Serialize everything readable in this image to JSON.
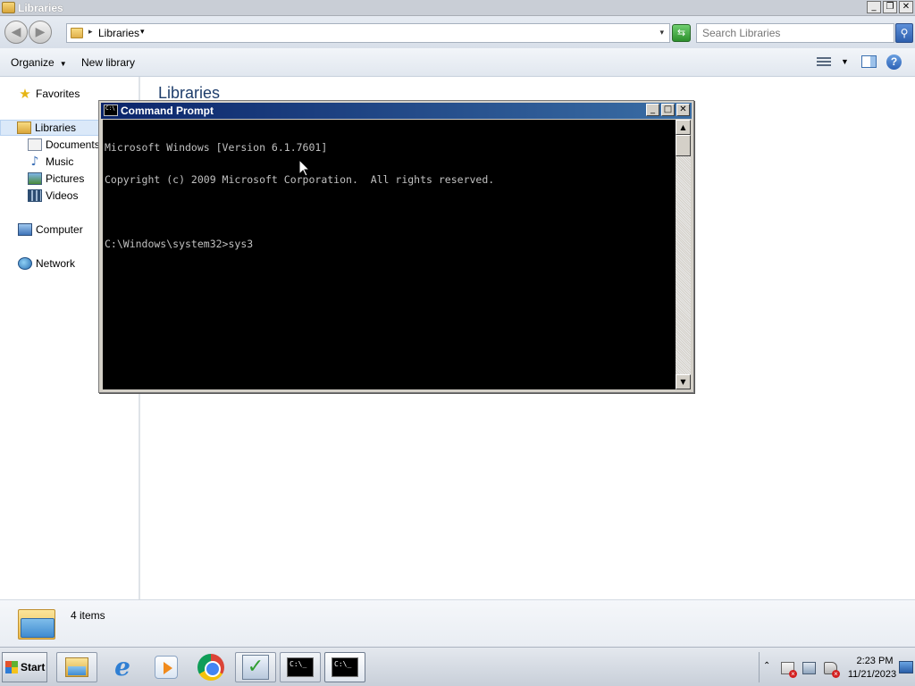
{
  "explorer": {
    "title": "Libraries",
    "window_buttons": [
      "_",
      "❐",
      "✕"
    ],
    "nav": {
      "back": "◀",
      "forward": "▶"
    },
    "address": {
      "path": "Libraries",
      "separator": "▸",
      "arrow": "▾",
      "dropdown": "▾"
    },
    "refresh_glyph": "⇆",
    "search": {
      "placeholder": "Search Libraries",
      "button": "⚲"
    },
    "toolbar": {
      "organize": "Organize",
      "organize_caret": "▼",
      "new_library": "New library",
      "views_caret": "▼",
      "help": "?"
    },
    "sidebar": {
      "favorites": "Favorites",
      "libraries": "Libraries",
      "documents": "Documents",
      "music": "Music",
      "pictures": "Pictures",
      "videos": "Videos",
      "computer": "Computer",
      "network": "Network"
    },
    "content_title": "Libraries",
    "status": {
      "items": "4 items"
    }
  },
  "cmd": {
    "title": "Command Prompt",
    "window_buttons": [
      "_",
      "□",
      "✕"
    ],
    "lines": [
      "Microsoft Windows [Version 6.1.7601]",
      "Copyright (c) 2009 Microsoft Corporation.  All rights reserved.",
      "",
      "C:\\Windows\\system32>sys3"
    ],
    "scroll_up": "▲",
    "scroll_down": "▼"
  },
  "taskbar": {
    "start_label": "Start",
    "cmd_icon_text": "C:\\_",
    "tray_expand": "⌃",
    "time": "2:23 PM",
    "date": "11/21/2023"
  },
  "colors": {
    "console_bg": "#000000",
    "console_fg": "#c0c0c0",
    "cmd_title_gradient_start": "#0a246a",
    "cmd_title_gradient_end": "#3a6ea5",
    "content_title": "#1e3d6b"
  }
}
